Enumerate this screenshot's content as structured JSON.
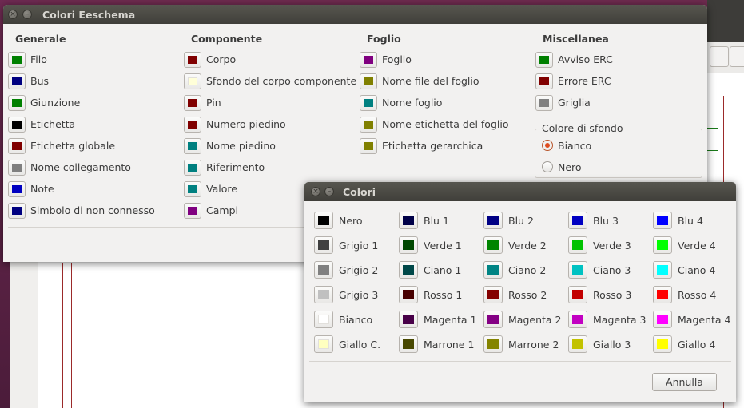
{
  "main_window": {
    "title": "Colori Eeschema",
    "columns": [
      {
        "title": "Generale",
        "items": [
          {
            "label": "Filo",
            "color": "#008000"
          },
          {
            "label": "Bus",
            "color": "#000080"
          },
          {
            "label": "Giunzione",
            "color": "#008000"
          },
          {
            "label": "Etichetta",
            "color": "#000000"
          },
          {
            "label": "Etichetta globale",
            "color": "#800000"
          },
          {
            "label": "Nome collegamento",
            "color": "#808080"
          },
          {
            "label": "Note",
            "color": "#0000c0"
          },
          {
            "label": "Simbolo di non connesso",
            "color": "#000080"
          }
        ]
      },
      {
        "title": "Componente",
        "items": [
          {
            "label": "Corpo",
            "color": "#800000"
          },
          {
            "label": "Sfondo del corpo componente",
            "color": "#ffffd8"
          },
          {
            "label": "Pin",
            "color": "#800000"
          },
          {
            "label": "Numero piedino",
            "color": "#800000"
          },
          {
            "label": "Nome piedino",
            "color": "#008080"
          },
          {
            "label": "Riferimento",
            "color": "#008080"
          },
          {
            "label": "Valore",
            "color": "#008080"
          },
          {
            "label": "Campi",
            "color": "#800080"
          }
        ]
      },
      {
        "title": "Foglio",
        "items": [
          {
            "label": "Foglio",
            "color": "#800080"
          },
          {
            "label": "Nome file del foglio",
            "color": "#808000"
          },
          {
            "label": "Nome foglio",
            "color": "#008080"
          },
          {
            "label": "Nome etichetta del foglio",
            "color": "#808000"
          },
          {
            "label": "Etichetta gerarchica",
            "color": "#808000"
          }
        ]
      },
      {
        "title": "Miscellanea",
        "items": [
          {
            "label": "Avviso ERC",
            "color": "#008000"
          },
          {
            "label": "Errore ERC",
            "color": "#800000"
          },
          {
            "label": "Griglia",
            "color": "#808080"
          }
        ]
      }
    ],
    "background": {
      "title": "Colore di sfondo",
      "options": [
        {
          "label": "Bianco",
          "selected": true
        },
        {
          "label": "Nero",
          "selected": false
        }
      ]
    }
  },
  "colors_window": {
    "title": "Colori",
    "palette": [
      [
        {
          "label": "Nero",
          "color": "#000000"
        },
        {
          "label": "Grigio 1",
          "color": "#404040"
        },
        {
          "label": "Grigio 2",
          "color": "#808080"
        },
        {
          "label": "Grigio 3",
          "color": "#c0c0c0"
        },
        {
          "label": "Bianco",
          "color": "#ffffff"
        },
        {
          "label": "Giallo C.",
          "color": "#ffffc0"
        }
      ],
      [
        {
          "label": "Blu 1",
          "color": "#000048"
        },
        {
          "label": "Verde 1",
          "color": "#004800"
        },
        {
          "label": "Ciano 1",
          "color": "#004848"
        },
        {
          "label": "Rosso 1",
          "color": "#480000"
        },
        {
          "label": "Magenta 1",
          "color": "#480048"
        },
        {
          "label": "Marrone 1",
          "color": "#484800"
        }
      ],
      [
        {
          "label": "Blu 2",
          "color": "#000084"
        },
        {
          "label": "Verde 2",
          "color": "#008400"
        },
        {
          "label": "Ciano 2",
          "color": "#008484"
        },
        {
          "label": "Rosso 2",
          "color": "#840000"
        },
        {
          "label": "Magenta 2",
          "color": "#840084"
        },
        {
          "label": "Marrone 2",
          "color": "#848400"
        }
      ],
      [
        {
          "label": "Blu 3",
          "color": "#0000c2"
        },
        {
          "label": "Verde 3",
          "color": "#00c200"
        },
        {
          "label": "Ciano 3",
          "color": "#00c2c2"
        },
        {
          "label": "Rosso 3",
          "color": "#c20000"
        },
        {
          "label": "Magenta 3",
          "color": "#c200c2"
        },
        {
          "label": "Giallo 3",
          "color": "#c2c200"
        }
      ],
      [
        {
          "label": "Blu 4",
          "color": "#0000ff"
        },
        {
          "label": "Verde 4",
          "color": "#00ff00"
        },
        {
          "label": "Ciano 4",
          "color": "#00ffff"
        },
        {
          "label": "Rosso 4",
          "color": "#ff0000"
        },
        {
          "label": "Magenta 4",
          "color": "#ff00ff"
        },
        {
          "label": "Giallo 4",
          "color": "#ffff00"
        }
      ]
    ],
    "cancel_label": "Annulla"
  }
}
